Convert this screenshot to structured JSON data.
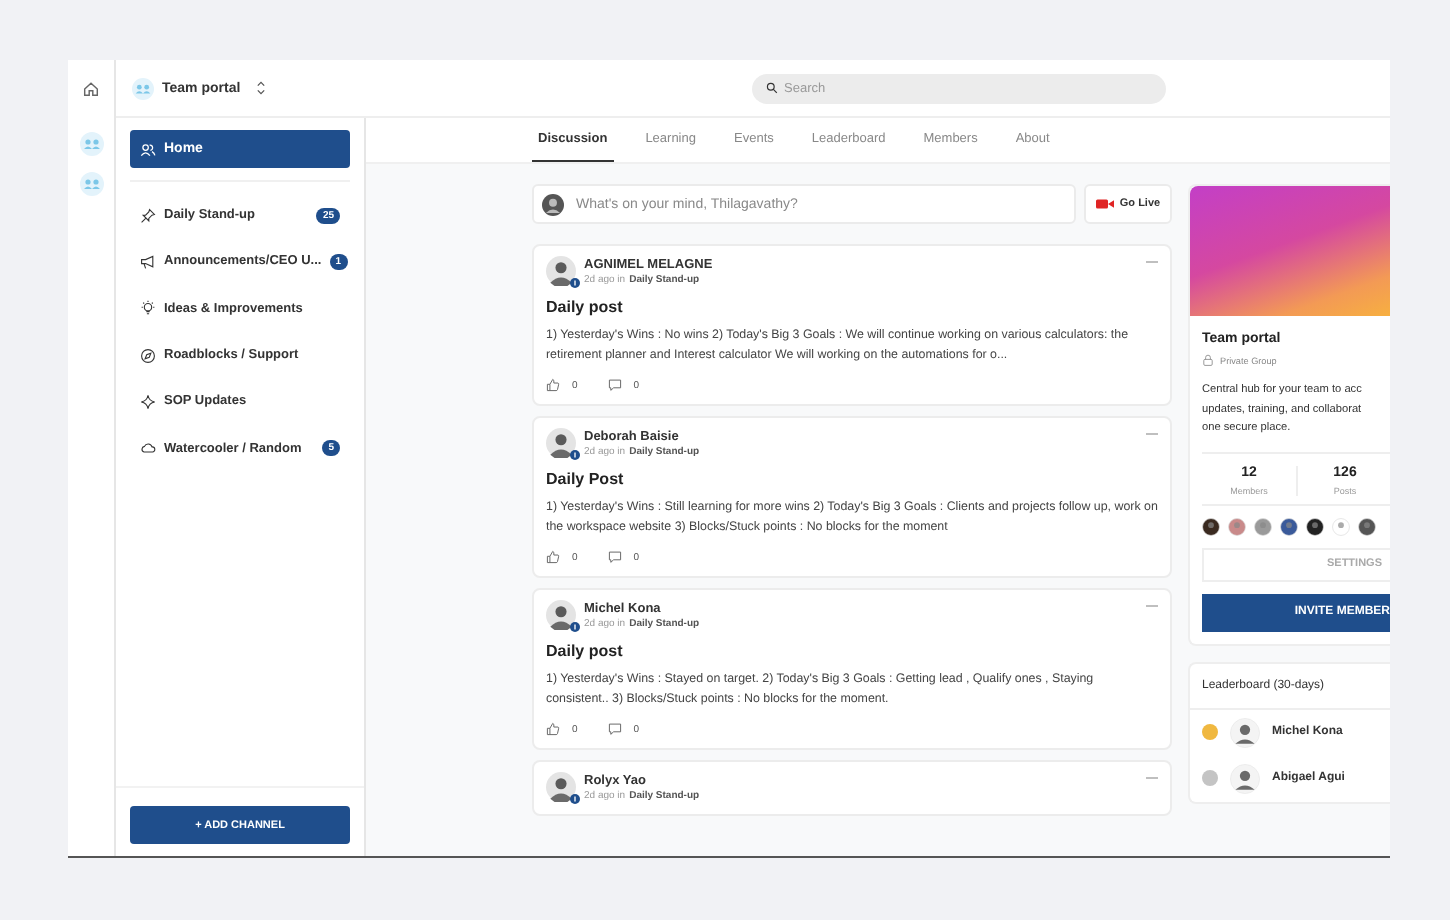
{
  "topbar": {
    "portal": "Team portal",
    "search": {
      "placeholder": "Search"
    }
  },
  "sidebar": {
    "home": {
      "label": "Home",
      "selected": true
    },
    "channels": [
      {
        "label": "Daily Stand-up",
        "kind": "pin",
        "badge": "25"
      },
      {
        "label": "Announcements/CEO U...",
        "kind": "megaphone",
        "badge": "1"
      },
      {
        "label": "Ideas & Improvements",
        "kind": "bulb"
      },
      {
        "label": "Roadblocks / Support",
        "kind": "compass"
      },
      {
        "label": "SOP Updates",
        "kind": "sparkle"
      },
      {
        "label": "Watercooler / Random",
        "kind": "cloud",
        "badge": "5"
      }
    ],
    "add_button": "+ ADD CHANNEL"
  },
  "tabs": [
    {
      "label": "Discussion",
      "selected": true
    },
    {
      "label": "Learning",
      "selected": false
    },
    {
      "label": "Events",
      "selected": false
    },
    {
      "label": "Leaderboard",
      "selected": false
    },
    {
      "label": "Members",
      "selected": false
    },
    {
      "label": "About",
      "selected": false
    }
  ],
  "composer": {
    "placeholder": "What's on your mind, Thilagavathy?",
    "live_button": "Go Live"
  },
  "posts": [
    {
      "author": "AGNIMEL MELAGNE",
      "time": "2d ago in",
      "channel": "Daily Stand-up",
      "title": "Daily post",
      "body": "1) Yesterday's Wins : No wins 2) Today's Big 3 Goals : We will continue working on various calculators: the retirement planner and Interest calculator We will working on the automations for o...",
      "likes": "0",
      "comments": "0"
    },
    {
      "author": "Deborah Baisie",
      "time": "2d ago in",
      "channel": "Daily Stand-up",
      "title": "Daily Post",
      "body": "1) Yesterday's Wins : Still learning for more wins 2) Today's Big 3 Goals : Clients and projects follow up, work on the workspace website 3) Blocks/Stuck points : No blocks for the moment",
      "likes": "0",
      "comments": "0"
    },
    {
      "author": "Michel Kona",
      "time": "2d ago in",
      "channel": "Daily Stand-up",
      "title": "Daily post",
      "body": "1) Yesterday's Wins : Stayed on target. 2) Today's Big 3 Goals : Getting lead , Qualify ones , Staying consistent.. 3) Blocks/Stuck points : No blocks for the moment.",
      "likes": "0",
      "comments": "0"
    },
    {
      "author": "Rolyx Yao",
      "time": "2d ago in",
      "channel": "Daily Stand-up"
    }
  ],
  "group": {
    "name": "Team portal",
    "privacy": "Private Group",
    "description": [
      "Central hub for your team to acc",
      "updates, training, and collaborat",
      "one secure place."
    ],
    "stats": [
      {
        "value": "12",
        "label": "Members"
      },
      {
        "value": "126",
        "label": "Posts"
      }
    ],
    "settings_button": "SETTINGS",
    "invite_button": "INVITE MEMBER"
  },
  "leaderboard": {
    "title": "Leaderboard (30-days)",
    "entries": [
      {
        "name": "Michel Kona",
        "color": "#f0b840"
      },
      {
        "name": "Abigael Agui",
        "color": "#c4c4c4"
      }
    ]
  }
}
